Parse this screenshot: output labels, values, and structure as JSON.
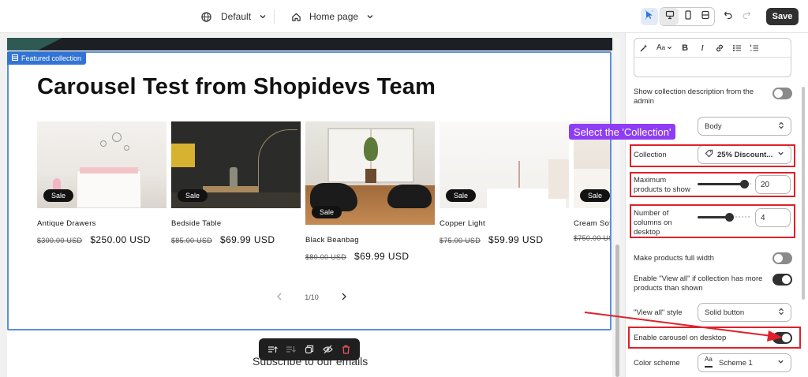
{
  "topbar": {
    "theme_label": "Default",
    "page_label": "Home page",
    "save_label": "Save",
    "icons": [
      "globe-icon",
      "chevron-down-icon",
      "home-icon",
      "chevron-down-icon",
      "inspector-icon",
      "desktop-icon",
      "mobile-icon",
      "fullwidth-icon",
      "undo-icon",
      "redo-icon"
    ]
  },
  "section_tag": "Featured collection",
  "heading": "Carousel Test from Shopidevs Team",
  "products": [
    {
      "title": "Antique Drawers",
      "old_price": "$300.00 USD",
      "new_price": "$250.00 USD",
      "badge": "Sale"
    },
    {
      "title": "Bedside Table",
      "old_price": "$85.00 USD",
      "new_price": "$69.99 USD",
      "badge": "Sale"
    },
    {
      "title": "Black Beanbag",
      "old_price": "$80.00 USD",
      "new_price": "$69.99 USD",
      "badge": "Sale"
    },
    {
      "title": "Copper Light",
      "old_price": "$75.00 USD",
      "new_price": "$59.99 USD",
      "badge": "Sale"
    },
    {
      "title": "Cream Sof",
      "old_price": "$750.00 US",
      "new_price": "",
      "badge": "Sale"
    }
  ],
  "pager": {
    "text": "1/10"
  },
  "subscribe_text": "Subscribe to our emails",
  "floating_toolbar_icons": [
    "move-up-icon",
    "move-down-icon",
    "duplicate-icon",
    "hide-icon",
    "delete-icon"
  ],
  "settings": {
    "show_description_label": "Show collection description from the admin",
    "show_description_on": false,
    "description_style_label_visible": "Body",
    "tooltip": "Select the 'Collection'",
    "collection_label": "Collection",
    "collection_value": "25% Discount...",
    "max_products_label": "Maximum products to show",
    "max_products_value": "20",
    "max_products_fraction": 0.9,
    "columns_label": "Number of columns on desktop",
    "columns_value": "4",
    "columns_fraction": 0.6,
    "full_width_label": "Make products full width",
    "full_width_on": false,
    "view_all_label": "Enable \"View all\" if collection has more products than shown",
    "view_all_on": true,
    "view_all_style_label": "\"View all\" style",
    "view_all_style_value": "Solid button",
    "carousel_label": "Enable carousel on desktop",
    "carousel_on": true,
    "color_scheme_label": "Color scheme",
    "color_scheme_value": "Scheme 1"
  },
  "colors": {
    "accent": "#3273d6",
    "annotation": "#e0202a",
    "tooltip": "#8e3df5"
  }
}
